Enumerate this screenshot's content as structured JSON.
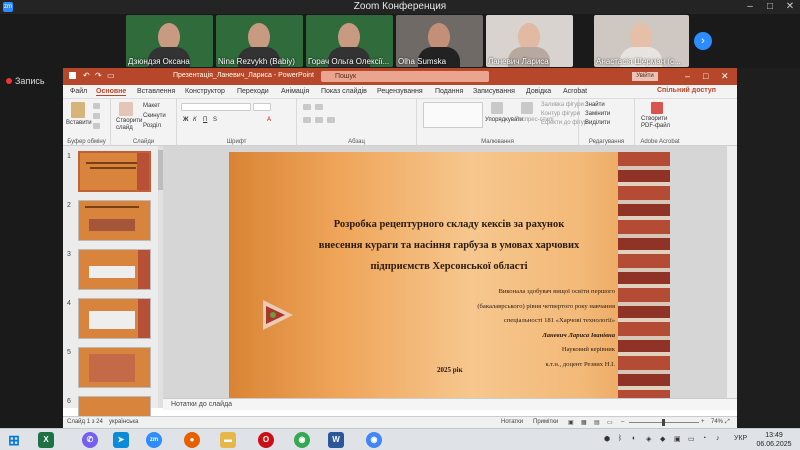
{
  "zoom": {
    "title": "Zoom Конференция",
    "participants": [
      {
        "name": "Дзюндзя Оксана"
      },
      {
        "name": "Nina Rezvykh (Babiy)"
      },
      {
        "name": "Горач Ольга Олексії..."
      },
      {
        "name": "Olha Sumska"
      },
      {
        "name": "Ланевич Лариса"
      },
      {
        "name": "Анастасія Шерман (с..."
      }
    ],
    "recording_label": "Запись"
  },
  "ppt": {
    "doc_title": "Презентація_Ланевич_Лариса  -  PowerPoint",
    "search_placeholder": "Пошук",
    "signin_label": "Увійти",
    "share_label": "Спільний доступ",
    "tabs": [
      "Файл",
      "Основне",
      "Вставлення",
      "Конструктор",
      "Переходи",
      "Анімація",
      "Показ слайдів",
      "Рецензування",
      "Подання",
      "Записування",
      "Довідка",
      "Acrobat"
    ],
    "ribbon": {
      "paste": "Вставити",
      "clipboard_group": "Буфер обміну",
      "new_slide": "Створити слайд",
      "layout": "Макет",
      "reset": "Скинути",
      "section": "Розділ",
      "slides_group": "Слайди",
      "font_group": "Шрифт",
      "paragraph_group": "Абзац",
      "arrange": "Упорядкувати",
      "quick_styles": "Експрес-стилі",
      "shape_fill": "Заливка фігури",
      "shape_outline": "Контур фігури",
      "shape_effects": "Ефекти до фігур",
      "drawing_group": "Малювання",
      "find": "Знайти",
      "replace": "Замінити",
      "select": "Виділити",
      "editing_group": "Редагування",
      "create_pdf": "Створити PDF-файл",
      "acrobat_group": "Adobe Acrobat"
    },
    "thumbnail_numbers": [
      "1",
      "2",
      "3",
      "4",
      "5",
      "6"
    ],
    "slide": {
      "title_lines": [
        "Розробка рецептурного складу кексів за рахунок",
        "внесення кураги та насіння гарбуза в умовах харчових",
        "підприємств Херсонської області"
      ],
      "author_lines": [
        "Виконала здобувач вищої освіти першого",
        "(бакалаврського) рівня четвертого року навчання",
        "спеціальності 181 «Харчові технології»",
        "Ланевич Лариса Іванівна",
        "Науковий керівник",
        "к.т.н., доцент Резвих Н.І."
      ],
      "year": "2025 рік"
    },
    "notes_placeholder": "Нотатки до слайда",
    "status": {
      "slide_counter": "Слайд 1 з 24",
      "language": "українська",
      "notes_btn": "Нотатки",
      "comments_btn": "Примітки",
      "zoom_pct": "74%"
    }
  },
  "taskbar": {
    "lang": "УКР",
    "time": "13:49",
    "date": "06.06.2025"
  }
}
